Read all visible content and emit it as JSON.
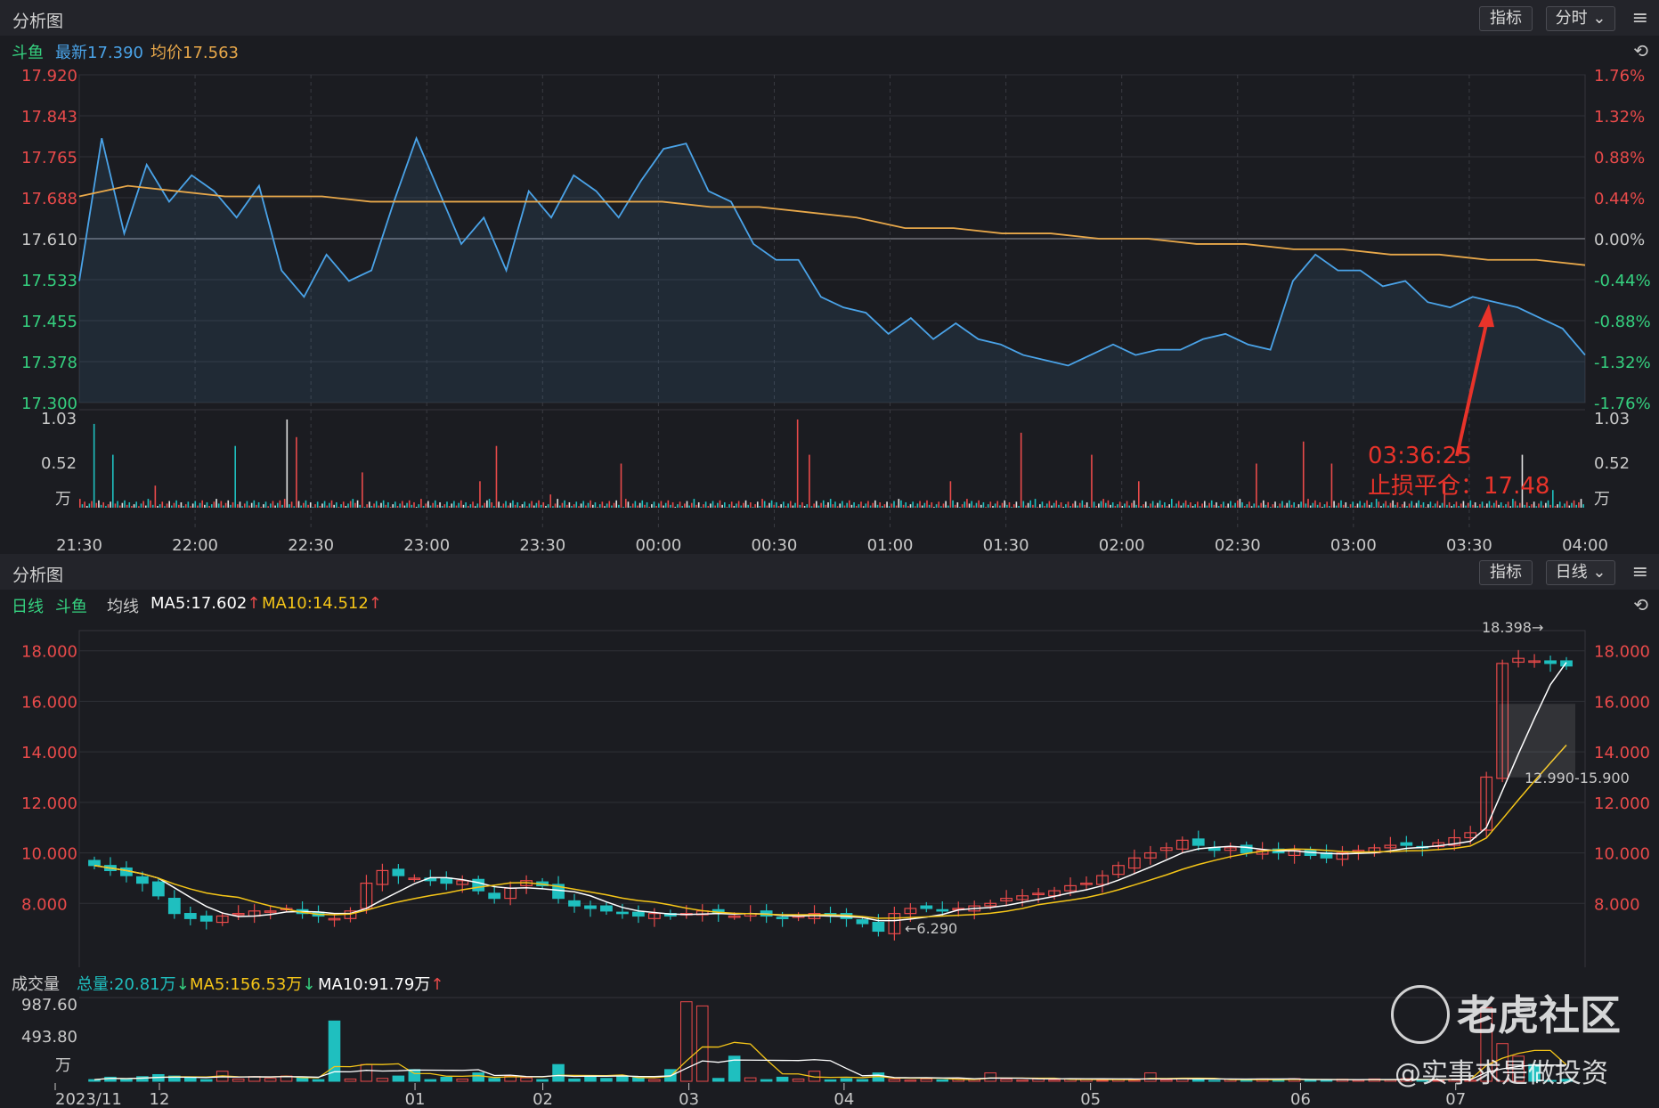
{
  "top_panel": {
    "title": "分析图",
    "indicator_button": "指标",
    "period_button": "分时",
    "stock_name": "斗鱼",
    "latest_label": "最新17.390",
    "avg_label": "均价17.563"
  },
  "bottom_panel": {
    "title": "分析图",
    "indicator_button": "指标",
    "period_button": "日线",
    "period_label": "日线",
    "stock_name": "斗鱼",
    "ma_title": "均线",
    "ma5_label": "MA5:17.602",
    "ma10_label": "MA10:14.512",
    "volume_title": "成交量",
    "vol_total_label": "总量:20.81万",
    "vol_ma5_label": "MA5:156.53万",
    "vol_ma10_label": "MA10:91.79万"
  },
  "colors": {
    "price_line": "#4aa3e8",
    "avg_line": "#e8a84a",
    "up": "#e84a4a",
    "down": "#1fbfbf",
    "ma5": "#ffffff",
    "ma10": "#f5c518"
  },
  "annotation": {
    "time": "03:36:25",
    "text": "止损平仓：17.48"
  },
  "watermark": {
    "brand": "老虎社区",
    "author": "@实事求是做投资"
  },
  "chart_data": [
    {
      "type": "line",
      "name": "intraday",
      "x": [
        "21:30",
        "22:00",
        "22:30",
        "23:00",
        "23:30",
        "00:00",
        "00:30",
        "01:00",
        "01:30",
        "02:00",
        "02:30",
        "03:00",
        "03:30",
        "04:00"
      ],
      "y_ticks": [
        "17.920",
        "17.843",
        "17.765",
        "17.688",
        "17.610",
        "17.533",
        "17.455",
        "17.378",
        "17.300"
      ],
      "y_ticks_right": [
        "1.76%",
        "1.32%",
        "0.88%",
        "0.44%",
        "0.00%",
        "-0.44%",
        "-0.88%",
        "-1.32%",
        "-1.76%"
      ],
      "ylim": [
        17.3,
        17.92
      ],
      "series": [
        {
          "name": "最新",
          "values": [
            17.53,
            17.8,
            17.62,
            17.75,
            17.68,
            17.73,
            17.7,
            17.65,
            17.71,
            17.55,
            17.5,
            17.58,
            17.53,
            17.55,
            17.68,
            17.8,
            17.7,
            17.6,
            17.65,
            17.55,
            17.7,
            17.65,
            17.73,
            17.7,
            17.65,
            17.72,
            17.78,
            17.79,
            17.7,
            17.68,
            17.6,
            17.57,
            17.57,
            17.5,
            17.48,
            17.47,
            17.43,
            17.46,
            17.42,
            17.45,
            17.42,
            17.41,
            17.39,
            17.38,
            17.37,
            17.39,
            17.41,
            17.39,
            17.4,
            17.4,
            17.42,
            17.43,
            17.41,
            17.4,
            17.53,
            17.58,
            17.55,
            17.55,
            17.52,
            17.53,
            17.49,
            17.48,
            17.5,
            17.49,
            17.48,
            17.46,
            17.44,
            17.39
          ]
        },
        {
          "name": "均价",
          "values": [
            17.69,
            17.71,
            17.7,
            17.69,
            17.69,
            17.69,
            17.68,
            17.68,
            17.68,
            17.68,
            17.68,
            17.68,
            17.68,
            17.67,
            17.67,
            17.66,
            17.65,
            17.63,
            17.63,
            17.62,
            17.62,
            17.61,
            17.61,
            17.6,
            17.6,
            17.59,
            17.59,
            17.58,
            17.58,
            17.57,
            17.57,
            17.56
          ]
        }
      ],
      "annotation_price": 17.48
    },
    {
      "type": "bar",
      "name": "intraday-volume",
      "y_ticks": [
        "1.03",
        "0.52",
        "万"
      ],
      "ylim": [
        0,
        1.03
      ]
    },
    {
      "type": "candlestick",
      "name": "daily-kline",
      "x_ticks": [
        "2023/11",
        "12",
        "01",
        "02",
        "03",
        "04",
        "05",
        "06",
        "07"
      ],
      "y_ticks": [
        "18.000",
        "16.000",
        "14.000",
        "12.000",
        "10.000",
        "8.000"
      ],
      "ylim": [
        6.0,
        18.8
      ],
      "high_label": "18.398→",
      "low_label": "←6.290",
      "range_label": "12.990-15.900",
      "closes": [
        9.5,
        9.3,
        9.1,
        8.8,
        8.3,
        7.6,
        7.4,
        7.3,
        7.5,
        7.6,
        7.7,
        7.7,
        7.8,
        7.6,
        7.5,
        7.4,
        7.7,
        8.8,
        9.3,
        9.1,
        9.0,
        8.9,
        8.8,
        8.9,
        8.5,
        8.2,
        8.6,
        8.9,
        8.7,
        8.2,
        7.9,
        7.8,
        7.7,
        7.6,
        7.5,
        7.6,
        7.5,
        7.6,
        7.7,
        7.6,
        7.5,
        7.6,
        7.5,
        7.4,
        7.5,
        7.6,
        7.5,
        7.4,
        7.2,
        6.9,
        7.6,
        7.8,
        7.8,
        7.7,
        7.8,
        7.9,
        8.0,
        8.2,
        8.3,
        8.4,
        8.5,
        8.7,
        8.8,
        9.1,
        9.5,
        9.8,
        10.0,
        10.2,
        10.5,
        10.3,
        10.1,
        10.2,
        10.0,
        10.1,
        10.0,
        10.1,
        9.9,
        9.8,
        10.0,
        10.1,
        10.2,
        10.3,
        10.3,
        10.2,
        10.4,
        10.6,
        10.8,
        13.0,
        17.5,
        17.7,
        17.6,
        17.5,
        17.4
      ]
    },
    {
      "type": "bar",
      "name": "daily-volume",
      "y_ticks": [
        "987.60",
        "493.80",
        "万"
      ],
      "ylim": [
        0,
        987.6
      ]
    }
  ]
}
